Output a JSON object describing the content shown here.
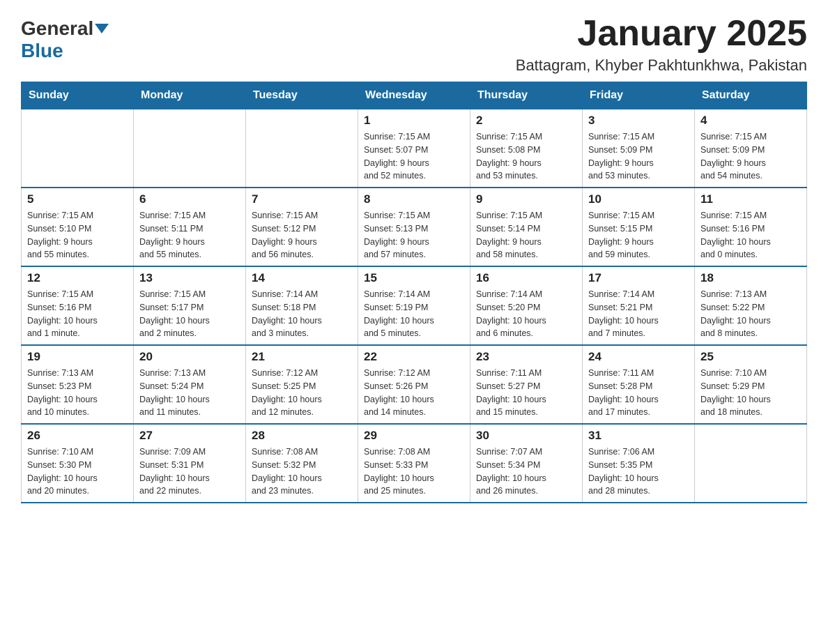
{
  "logo": {
    "general": "General",
    "blue": "Blue"
  },
  "title": "January 2025",
  "location": "Battagram, Khyber Pakhtunkhwa, Pakistan",
  "days_of_week": [
    "Sunday",
    "Monday",
    "Tuesday",
    "Wednesday",
    "Thursday",
    "Friday",
    "Saturday"
  ],
  "weeks": [
    [
      {
        "day": "",
        "info": ""
      },
      {
        "day": "",
        "info": ""
      },
      {
        "day": "",
        "info": ""
      },
      {
        "day": "1",
        "info": "Sunrise: 7:15 AM\nSunset: 5:07 PM\nDaylight: 9 hours\nand 52 minutes."
      },
      {
        "day": "2",
        "info": "Sunrise: 7:15 AM\nSunset: 5:08 PM\nDaylight: 9 hours\nand 53 minutes."
      },
      {
        "day": "3",
        "info": "Sunrise: 7:15 AM\nSunset: 5:09 PM\nDaylight: 9 hours\nand 53 minutes."
      },
      {
        "day": "4",
        "info": "Sunrise: 7:15 AM\nSunset: 5:09 PM\nDaylight: 9 hours\nand 54 minutes."
      }
    ],
    [
      {
        "day": "5",
        "info": "Sunrise: 7:15 AM\nSunset: 5:10 PM\nDaylight: 9 hours\nand 55 minutes."
      },
      {
        "day": "6",
        "info": "Sunrise: 7:15 AM\nSunset: 5:11 PM\nDaylight: 9 hours\nand 55 minutes."
      },
      {
        "day": "7",
        "info": "Sunrise: 7:15 AM\nSunset: 5:12 PM\nDaylight: 9 hours\nand 56 minutes."
      },
      {
        "day": "8",
        "info": "Sunrise: 7:15 AM\nSunset: 5:13 PM\nDaylight: 9 hours\nand 57 minutes."
      },
      {
        "day": "9",
        "info": "Sunrise: 7:15 AM\nSunset: 5:14 PM\nDaylight: 9 hours\nand 58 minutes."
      },
      {
        "day": "10",
        "info": "Sunrise: 7:15 AM\nSunset: 5:15 PM\nDaylight: 9 hours\nand 59 minutes."
      },
      {
        "day": "11",
        "info": "Sunrise: 7:15 AM\nSunset: 5:16 PM\nDaylight: 10 hours\nand 0 minutes."
      }
    ],
    [
      {
        "day": "12",
        "info": "Sunrise: 7:15 AM\nSunset: 5:16 PM\nDaylight: 10 hours\nand 1 minute."
      },
      {
        "day": "13",
        "info": "Sunrise: 7:15 AM\nSunset: 5:17 PM\nDaylight: 10 hours\nand 2 minutes."
      },
      {
        "day": "14",
        "info": "Sunrise: 7:14 AM\nSunset: 5:18 PM\nDaylight: 10 hours\nand 3 minutes."
      },
      {
        "day": "15",
        "info": "Sunrise: 7:14 AM\nSunset: 5:19 PM\nDaylight: 10 hours\nand 5 minutes."
      },
      {
        "day": "16",
        "info": "Sunrise: 7:14 AM\nSunset: 5:20 PM\nDaylight: 10 hours\nand 6 minutes."
      },
      {
        "day": "17",
        "info": "Sunrise: 7:14 AM\nSunset: 5:21 PM\nDaylight: 10 hours\nand 7 minutes."
      },
      {
        "day": "18",
        "info": "Sunrise: 7:13 AM\nSunset: 5:22 PM\nDaylight: 10 hours\nand 8 minutes."
      }
    ],
    [
      {
        "day": "19",
        "info": "Sunrise: 7:13 AM\nSunset: 5:23 PM\nDaylight: 10 hours\nand 10 minutes."
      },
      {
        "day": "20",
        "info": "Sunrise: 7:13 AM\nSunset: 5:24 PM\nDaylight: 10 hours\nand 11 minutes."
      },
      {
        "day": "21",
        "info": "Sunrise: 7:12 AM\nSunset: 5:25 PM\nDaylight: 10 hours\nand 12 minutes."
      },
      {
        "day": "22",
        "info": "Sunrise: 7:12 AM\nSunset: 5:26 PM\nDaylight: 10 hours\nand 14 minutes."
      },
      {
        "day": "23",
        "info": "Sunrise: 7:11 AM\nSunset: 5:27 PM\nDaylight: 10 hours\nand 15 minutes."
      },
      {
        "day": "24",
        "info": "Sunrise: 7:11 AM\nSunset: 5:28 PM\nDaylight: 10 hours\nand 17 minutes."
      },
      {
        "day": "25",
        "info": "Sunrise: 7:10 AM\nSunset: 5:29 PM\nDaylight: 10 hours\nand 18 minutes."
      }
    ],
    [
      {
        "day": "26",
        "info": "Sunrise: 7:10 AM\nSunset: 5:30 PM\nDaylight: 10 hours\nand 20 minutes."
      },
      {
        "day": "27",
        "info": "Sunrise: 7:09 AM\nSunset: 5:31 PM\nDaylight: 10 hours\nand 22 minutes."
      },
      {
        "day": "28",
        "info": "Sunrise: 7:08 AM\nSunset: 5:32 PM\nDaylight: 10 hours\nand 23 minutes."
      },
      {
        "day": "29",
        "info": "Sunrise: 7:08 AM\nSunset: 5:33 PM\nDaylight: 10 hours\nand 25 minutes."
      },
      {
        "day": "30",
        "info": "Sunrise: 7:07 AM\nSunset: 5:34 PM\nDaylight: 10 hours\nand 26 minutes."
      },
      {
        "day": "31",
        "info": "Sunrise: 7:06 AM\nSunset: 5:35 PM\nDaylight: 10 hours\nand 28 minutes."
      },
      {
        "day": "",
        "info": ""
      }
    ]
  ]
}
